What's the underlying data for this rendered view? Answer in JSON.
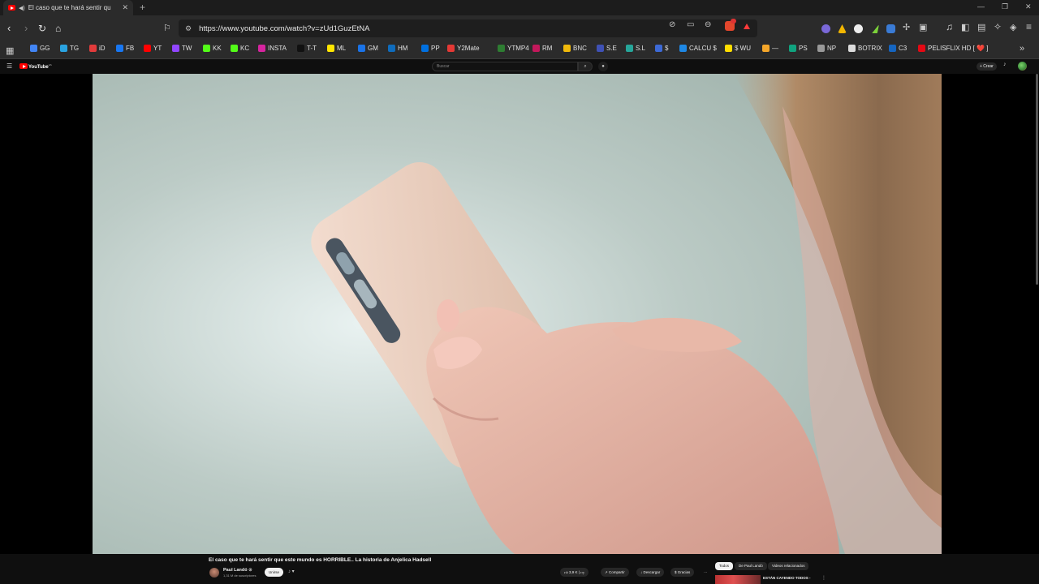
{
  "browser": {
    "tab_title": "El caso que te hará sentir qu",
    "new_tab": "+",
    "url": "https://www.youtube.com/watch?v=zUd1GuzEtNA",
    "window_controls": [
      "—",
      "❐",
      "✕"
    ]
  },
  "bookmarks": [
    {
      "label": "GG",
      "color": "#4285f4"
    },
    {
      "label": "TG",
      "color": "#2aa3e0"
    },
    {
      "label": "iD",
      "color": "#e23b3b"
    },
    {
      "label": "FB",
      "color": "#1877f2"
    },
    {
      "label": "YT",
      "color": "#ff0000"
    },
    {
      "label": "TW",
      "color": "#9146ff"
    },
    {
      "label": "KK",
      "color": "#53fc18"
    },
    {
      "label": "KC",
      "color": "#53fc18"
    },
    {
      "label": "INSTA",
      "color": "#d6249f"
    },
    {
      "label": "T-T",
      "color": "#111111"
    },
    {
      "label": "ML",
      "color": "#ffe600"
    },
    {
      "label": "GM",
      "color": "#1a73e8"
    },
    {
      "label": "HM",
      "color": "#0f6cbd"
    },
    {
      "label": "PP",
      "color": "#0070e0"
    },
    {
      "label": "Y2Mate",
      "color": "#e53935"
    },
    {
      "label": "YTMP4",
      "color": "#2e7d32"
    },
    {
      "label": "RM",
      "color": "#c2185b"
    },
    {
      "label": "BNC",
      "color": "#f0b90b"
    },
    {
      "label": "S.E",
      "color": "#3f51b5"
    },
    {
      "label": "S.L",
      "color": "#26a69a"
    },
    {
      "label": "$",
      "color": "#3d6ad6"
    },
    {
      "label": "CALCU $",
      "color": "#1e88e5"
    },
    {
      "label": "$ WU",
      "color": "#ffdd00"
    },
    {
      "label": "—",
      "color": "#f4a62a"
    },
    {
      "label": "PS",
      "color": "#10a37f"
    },
    {
      "label": "NP",
      "color": "#999999"
    },
    {
      "label": "BOTRIX",
      "color": "#dddddd"
    },
    {
      "label": "C3",
      "color": "#1565c0"
    },
    {
      "label": "PELISFLIX HD [ ❤️ ]",
      "color": "#e50914"
    }
  ],
  "youtube": {
    "logo_text": "YouTube",
    "country": "ES",
    "search_placeholder": "Buscar",
    "create_label": "+ Crear",
    "video": {
      "title": "El caso que te hará sentir que este mundo es HORRIBLE.. La historia de Anjelica Hadsell",
      "channel": "Paul Landó ⊙",
      "subscribers": "1,31 M de suscriptores",
      "subscribe_label": "Unirse",
      "likes": "3,9 K",
      "share_label": "Compartir",
      "download_label": "Descargar",
      "thanks_label": "Gracias",
      "more_label": "···"
    },
    "chips": [
      "Todos",
      "De Paul Landó",
      "Videos relacionados"
    ],
    "recommended": {
      "title": "ESTÁN CAYENDO TODOS -"
    }
  }
}
